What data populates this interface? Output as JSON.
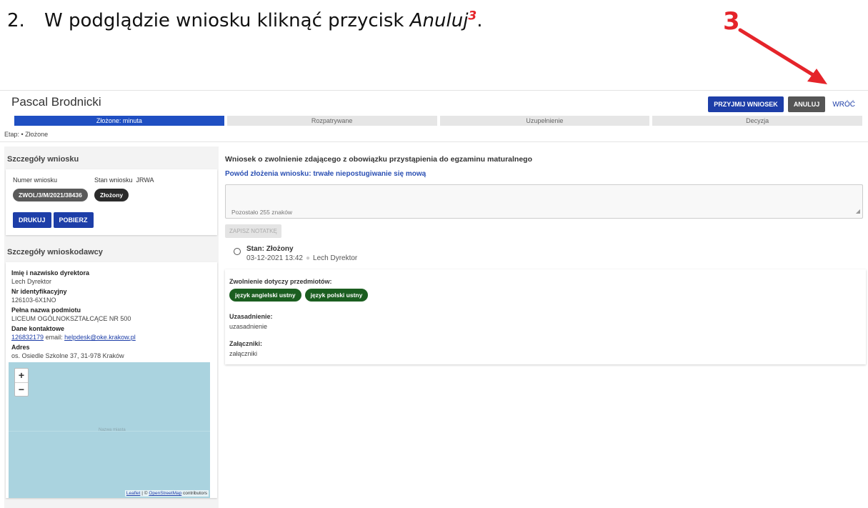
{
  "instruction": {
    "number": "2.",
    "text_before": "W podglądzie wniosku kliknąć przycisk ",
    "button_name": "Anuluj",
    "footnote": "3",
    "text_after": ".",
    "callout_number": "3",
    "callout_color": "#e5242a"
  },
  "app": {
    "title": "Pascal Brodnicki",
    "actions": {
      "accept": "PRZYJMIJ WNIOSEK",
      "cancel": "ANULUJ",
      "back": "WRÓĆ"
    },
    "steps": [
      {
        "label": "Złożone: minuta",
        "active": true
      },
      {
        "label": "Rozpatrywane",
        "active": false
      },
      {
        "label": "Uzupełnienie",
        "active": false
      },
      {
        "label": "Decyzja",
        "active": false
      }
    ],
    "stage": "Etap: • Złożone",
    "colors": {
      "primary": "#1d3ea8",
      "active_step": "#1f4fc2",
      "green_chip": "#1b5e20"
    }
  },
  "request_details": {
    "heading": "Szczegóły wniosku",
    "number_label": "Numer wniosku",
    "state_label": "Stan wniosku",
    "state_code": "JRWA",
    "number_value": "ZWOL/3/M/2021/38436",
    "state_value": "Złożony",
    "print_button": "DRUKUJ",
    "download_button": "POBIERZ"
  },
  "applicant": {
    "heading": "Szczegóły wnioskodawcy",
    "director_label": "Imię i nazwisko dyrektora",
    "director_value": "Lech Dyrektor",
    "id_label": "Nr identyfikacyjny",
    "id_value": "126103-6X1NO",
    "entity_label": "Pełna nazwa podmiotu",
    "entity_value": "LICEUM OGÓLNOKSZTAŁCĄCE NR 500",
    "contact_label": "Dane kontaktowe",
    "contact_phone": "126832179",
    "contact_email_prefix": " email: ",
    "contact_email": "helpdesk@oke.krakow.pl",
    "address_label": "Adres",
    "address_value": "os. Osiedle Szkolne 37, 31-978 Kraków"
  },
  "map": {
    "zoom_in": "+",
    "zoom_out": "−",
    "label": "Nazwa miasta",
    "attribution_leaflet": "Leaflet",
    "attribution_sep": " | © ",
    "attribution_osm": "OpenStreetMap",
    "attribution_suffix": " contributors"
  },
  "main": {
    "title": "Wniosek o zwolnienie zdającego z obowiązku przystąpienia do egzaminu maturalnego",
    "reason": "Powód złożenia wniosku: trwałe niepostugiwanie się mową",
    "note_remaining": "Pozostało 255 znaków",
    "save_note": "ZAPISZ NOTATKĘ",
    "history_title": "Stan: Złożony",
    "history_date": "03-12-2021 13:42",
    "history_user": "Lech Dyrektor",
    "subjects_label": "Zwolnienie dotyczy przedmiotów:",
    "subjects": [
      "język angielski ustny",
      "język polski ustny"
    ],
    "justification_label": "Uzasadnienie:",
    "justification_value": "uzasadnienie",
    "attachments_label": "Załączniki:",
    "attachments_value": "załączniki"
  }
}
